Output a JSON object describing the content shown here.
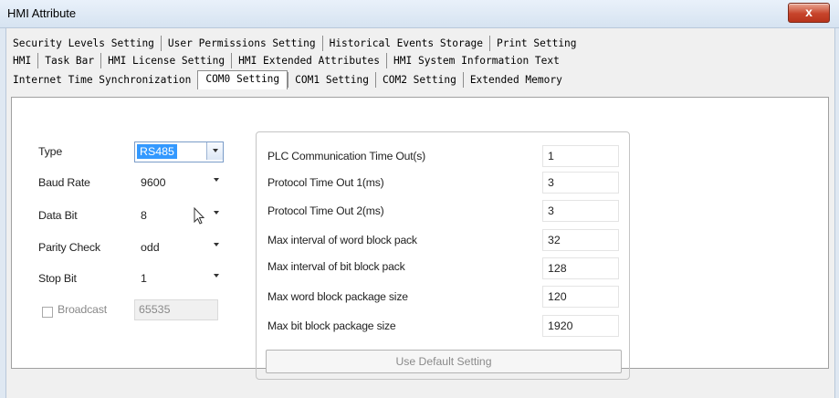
{
  "window": {
    "title": "HMI Attribute",
    "close_label": "x"
  },
  "tabs": {
    "row1": [
      "Security Levels Setting",
      "User Permissions Setting",
      "Historical Events Storage",
      "Print Setting"
    ],
    "row2": [
      "HMI",
      "Task Bar",
      "HMI License Setting",
      "HMI Extended Attributes",
      "HMI System Information Text"
    ],
    "row3": [
      "Internet Time Synchronization",
      "COM0 Setting",
      "COM1 Setting",
      "COM2 Setting",
      "Extended Memory"
    ],
    "active": "COM0 Setting"
  },
  "com_settings": {
    "type": {
      "label": "Type",
      "value": "RS485"
    },
    "baud_rate": {
      "label": "Baud Rate",
      "value": "9600"
    },
    "data_bit": {
      "label": "Data Bit",
      "value": "8"
    },
    "parity_check": {
      "label": "Parity Check",
      "value": "odd"
    },
    "stop_bit": {
      "label": "Stop Bit",
      "value": "1"
    },
    "broadcast": {
      "label": "Broadcast",
      "value": "65535",
      "checked": false
    }
  },
  "params": {
    "plc_timeout": {
      "label": "PLC Communication Time Out(s)",
      "value": "1"
    },
    "protocol_timeout_1": {
      "label": "Protocol Time Out 1(ms)",
      "value": "3"
    },
    "protocol_timeout_2": {
      "label": "Protocol Time Out 2(ms)",
      "value": "3"
    },
    "max_interval_word": {
      "label": "Max interval of word block pack",
      "value": "32"
    },
    "max_interval_bit": {
      "label": "Max interval of bit block pack",
      "value": "128"
    },
    "max_word_size": {
      "label": "Max word block package size",
      "value": "120"
    },
    "max_bit_size": {
      "label": "Max bit block package size",
      "value": "1920"
    }
  },
  "buttons": {
    "use_default": "Use Default Setting"
  }
}
